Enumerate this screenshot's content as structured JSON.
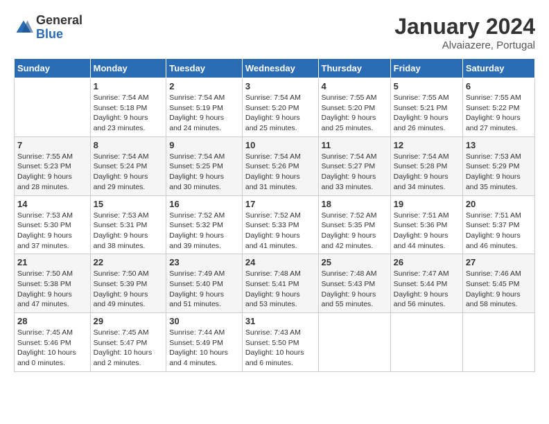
{
  "logo": {
    "general": "General",
    "blue": "Blue"
  },
  "title": "January 2024",
  "location": "Alvaiazere, Portugal",
  "days_of_week": [
    "Sunday",
    "Monday",
    "Tuesday",
    "Wednesday",
    "Thursday",
    "Friday",
    "Saturday"
  ],
  "weeks": [
    [
      {
        "day": "",
        "info": ""
      },
      {
        "day": "1",
        "info": "Sunrise: 7:54 AM\nSunset: 5:18 PM\nDaylight: 9 hours\nand 23 minutes."
      },
      {
        "day": "2",
        "info": "Sunrise: 7:54 AM\nSunset: 5:19 PM\nDaylight: 9 hours\nand 24 minutes."
      },
      {
        "day": "3",
        "info": "Sunrise: 7:54 AM\nSunset: 5:20 PM\nDaylight: 9 hours\nand 25 minutes."
      },
      {
        "day": "4",
        "info": "Sunrise: 7:55 AM\nSunset: 5:20 PM\nDaylight: 9 hours\nand 25 minutes."
      },
      {
        "day": "5",
        "info": "Sunrise: 7:55 AM\nSunset: 5:21 PM\nDaylight: 9 hours\nand 26 minutes."
      },
      {
        "day": "6",
        "info": "Sunrise: 7:55 AM\nSunset: 5:22 PM\nDaylight: 9 hours\nand 27 minutes."
      }
    ],
    [
      {
        "day": "7",
        "info": "Sunrise: 7:55 AM\nSunset: 5:23 PM\nDaylight: 9 hours\nand 28 minutes."
      },
      {
        "day": "8",
        "info": "Sunrise: 7:54 AM\nSunset: 5:24 PM\nDaylight: 9 hours\nand 29 minutes."
      },
      {
        "day": "9",
        "info": "Sunrise: 7:54 AM\nSunset: 5:25 PM\nDaylight: 9 hours\nand 30 minutes."
      },
      {
        "day": "10",
        "info": "Sunrise: 7:54 AM\nSunset: 5:26 PM\nDaylight: 9 hours\nand 31 minutes."
      },
      {
        "day": "11",
        "info": "Sunrise: 7:54 AM\nSunset: 5:27 PM\nDaylight: 9 hours\nand 33 minutes."
      },
      {
        "day": "12",
        "info": "Sunrise: 7:54 AM\nSunset: 5:28 PM\nDaylight: 9 hours\nand 34 minutes."
      },
      {
        "day": "13",
        "info": "Sunrise: 7:53 AM\nSunset: 5:29 PM\nDaylight: 9 hours\nand 35 minutes."
      }
    ],
    [
      {
        "day": "14",
        "info": "Sunrise: 7:53 AM\nSunset: 5:30 PM\nDaylight: 9 hours\nand 37 minutes."
      },
      {
        "day": "15",
        "info": "Sunrise: 7:53 AM\nSunset: 5:31 PM\nDaylight: 9 hours\nand 38 minutes."
      },
      {
        "day": "16",
        "info": "Sunrise: 7:52 AM\nSunset: 5:32 PM\nDaylight: 9 hours\nand 39 minutes."
      },
      {
        "day": "17",
        "info": "Sunrise: 7:52 AM\nSunset: 5:33 PM\nDaylight: 9 hours\nand 41 minutes."
      },
      {
        "day": "18",
        "info": "Sunrise: 7:52 AM\nSunset: 5:35 PM\nDaylight: 9 hours\nand 42 minutes."
      },
      {
        "day": "19",
        "info": "Sunrise: 7:51 AM\nSunset: 5:36 PM\nDaylight: 9 hours\nand 44 minutes."
      },
      {
        "day": "20",
        "info": "Sunrise: 7:51 AM\nSunset: 5:37 PM\nDaylight: 9 hours\nand 46 minutes."
      }
    ],
    [
      {
        "day": "21",
        "info": "Sunrise: 7:50 AM\nSunset: 5:38 PM\nDaylight: 9 hours\nand 47 minutes."
      },
      {
        "day": "22",
        "info": "Sunrise: 7:50 AM\nSunset: 5:39 PM\nDaylight: 9 hours\nand 49 minutes."
      },
      {
        "day": "23",
        "info": "Sunrise: 7:49 AM\nSunset: 5:40 PM\nDaylight: 9 hours\nand 51 minutes."
      },
      {
        "day": "24",
        "info": "Sunrise: 7:48 AM\nSunset: 5:41 PM\nDaylight: 9 hours\nand 53 minutes."
      },
      {
        "day": "25",
        "info": "Sunrise: 7:48 AM\nSunset: 5:43 PM\nDaylight: 9 hours\nand 55 minutes."
      },
      {
        "day": "26",
        "info": "Sunrise: 7:47 AM\nSunset: 5:44 PM\nDaylight: 9 hours\nand 56 minutes."
      },
      {
        "day": "27",
        "info": "Sunrise: 7:46 AM\nSunset: 5:45 PM\nDaylight: 9 hours\nand 58 minutes."
      }
    ],
    [
      {
        "day": "28",
        "info": "Sunrise: 7:45 AM\nSunset: 5:46 PM\nDaylight: 10 hours\nand 0 minutes."
      },
      {
        "day": "29",
        "info": "Sunrise: 7:45 AM\nSunset: 5:47 PM\nDaylight: 10 hours\nand 2 minutes."
      },
      {
        "day": "30",
        "info": "Sunrise: 7:44 AM\nSunset: 5:49 PM\nDaylight: 10 hours\nand 4 minutes."
      },
      {
        "day": "31",
        "info": "Sunrise: 7:43 AM\nSunset: 5:50 PM\nDaylight: 10 hours\nand 6 minutes."
      },
      {
        "day": "",
        "info": ""
      },
      {
        "day": "",
        "info": ""
      },
      {
        "day": "",
        "info": ""
      }
    ]
  ]
}
